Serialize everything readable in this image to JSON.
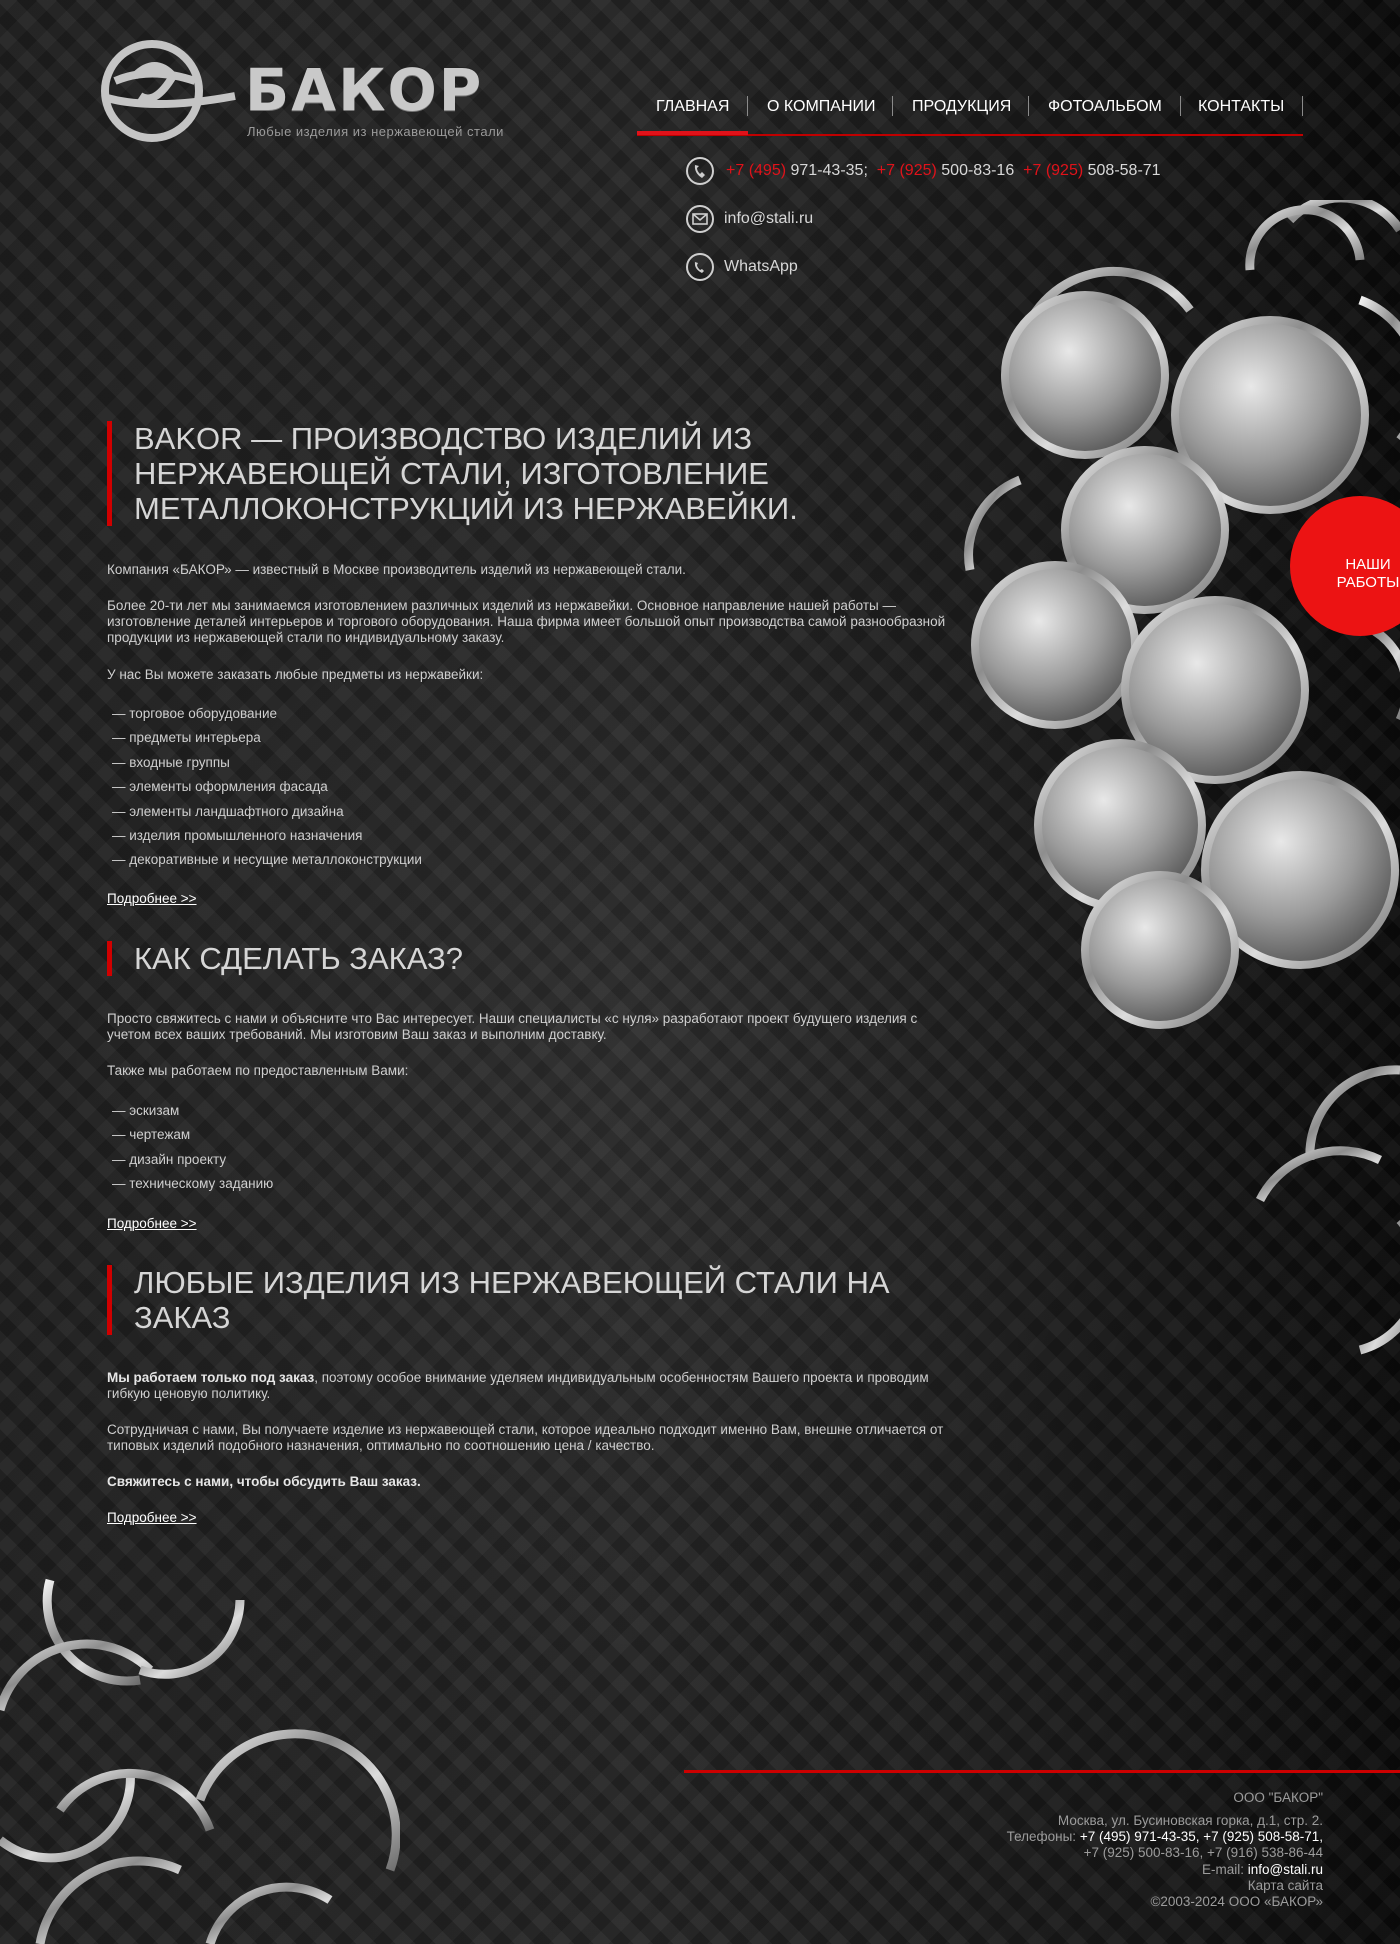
{
  "logo": {
    "name": "БАКОР",
    "tagline": "Любые изделия из нержавеющей стали"
  },
  "nav": {
    "items": [
      "ГЛАВНАЯ",
      "О КОМПАНИИ",
      "ПРОДУКЦИЯ",
      "ФОТОАЛЬБОМ",
      "КОНТАКТЫ"
    ],
    "active_index": 0
  },
  "contacts": {
    "phones": [
      {
        "code": "+7 (495)",
        "number": "971-43-35;"
      },
      {
        "code": "+7 (925)",
        "number": "500-83-16"
      },
      {
        "code": "+7 (925)",
        "number": "508-58-71"
      }
    ],
    "email": "info@stali.ru",
    "whatsapp": "WhatsApp"
  },
  "badge": {
    "line1": "НАШИ",
    "line2": "РАБОТЫ"
  },
  "section1": {
    "title_lines": [
      "BAKOR — ПРОИЗВОДСТВО ИЗДЕЛИЙ ИЗ",
      "НЕРЖАВЕЮЩЕЙ СТАЛИ, ИЗГОТОВЛЕНИЕ",
      "МЕТАЛЛОКОНСТРУКЦИЙ ИЗ НЕРЖАВЕЙКИ."
    ],
    "p1": "Компания «БАКОР» — известный в Москве производитель изделий из нержавеющей стали.",
    "p2_lines": [
      "Более 20-ти лет мы занимаемся изготовлением различных изделий из нержавейки. Основное направление нашей работы —",
      "изготовление деталей интерьеров и торгового оборудования. Наша фирма имеет большой опыт производства самой разнообразной",
      "продукции из нержавеющей стали по индивидуальному заказу."
    ],
    "p3": "У нас Вы можете заказать любые предметы из нержавейки:",
    "list": [
      "— торговое оборудование",
      "— предметы интерьера",
      "— входные группы",
      "— элементы оформления фасада",
      "— элементы ландшафтного дизайна",
      "— изделия промышленного назначения",
      "— декоративные и несущие металлоконструкции"
    ],
    "more": "Подробнее >>"
  },
  "section2": {
    "title": "КАК СДЕЛАТЬ ЗАКАЗ?",
    "p1_lines": [
      "Просто свяжитесь с нами и объясните что Вас интересует. Наши специалисты «с нуля» разработают проект будущего изделия с",
      "учетом всех ваших требований. Мы изготовим Ваш заказ и выполним доставку."
    ],
    "p2": "Также мы работаем по предоставленным Вами:",
    "list": [
      "— эскизам",
      "— чертежам",
      "— дизайн проекту",
      "— техническому заданию"
    ],
    "more": "Подробнее >>"
  },
  "section3": {
    "title_lines": [
      "ЛЮБЫЕ ИЗДЕЛИЯ ИЗ НЕРЖАВЕЮЩЕЙ СТАЛИ НА",
      "ЗАКАЗ"
    ],
    "p1_bold": "Мы работаем только под заказ",
    "p1_rest": ", поэтому особое внимание уделяем индивидуальным особенностям Вашего проекта и проводим",
    "p1_line2": "гибкую ценовую политику.",
    "p2_lines": [
      "Сотрудничая с нами, Вы получаете изделие из нержавеющей стали, которое идеально подходит именно Вам, внешне отличается от",
      "типовых изделий подобного назначения, оптимально по соотношению цена / качество."
    ],
    "p3": "Свяжитесь с нами, чтобы обсудить Ваш заказ.",
    "more": "Подробнее >>"
  },
  "footer": {
    "company": "ООО \"БАКОР\"",
    "address": "Москва, ул. Бусиновская горка, д.1, стр. 2.",
    "phones_label": "Телефоны:",
    "phones_line1": "+7 (495) 971-43-35, +7 (925) 508-58-71,",
    "phones_line2": "+7 (925) 500-83-16, +7 (916) 538-86-44",
    "email_label": "E-mail:",
    "email": "info@stali.ru",
    "sitemap": "Карта сайта",
    "copyright": "©2003-2024 ООО «БАКОР»"
  }
}
